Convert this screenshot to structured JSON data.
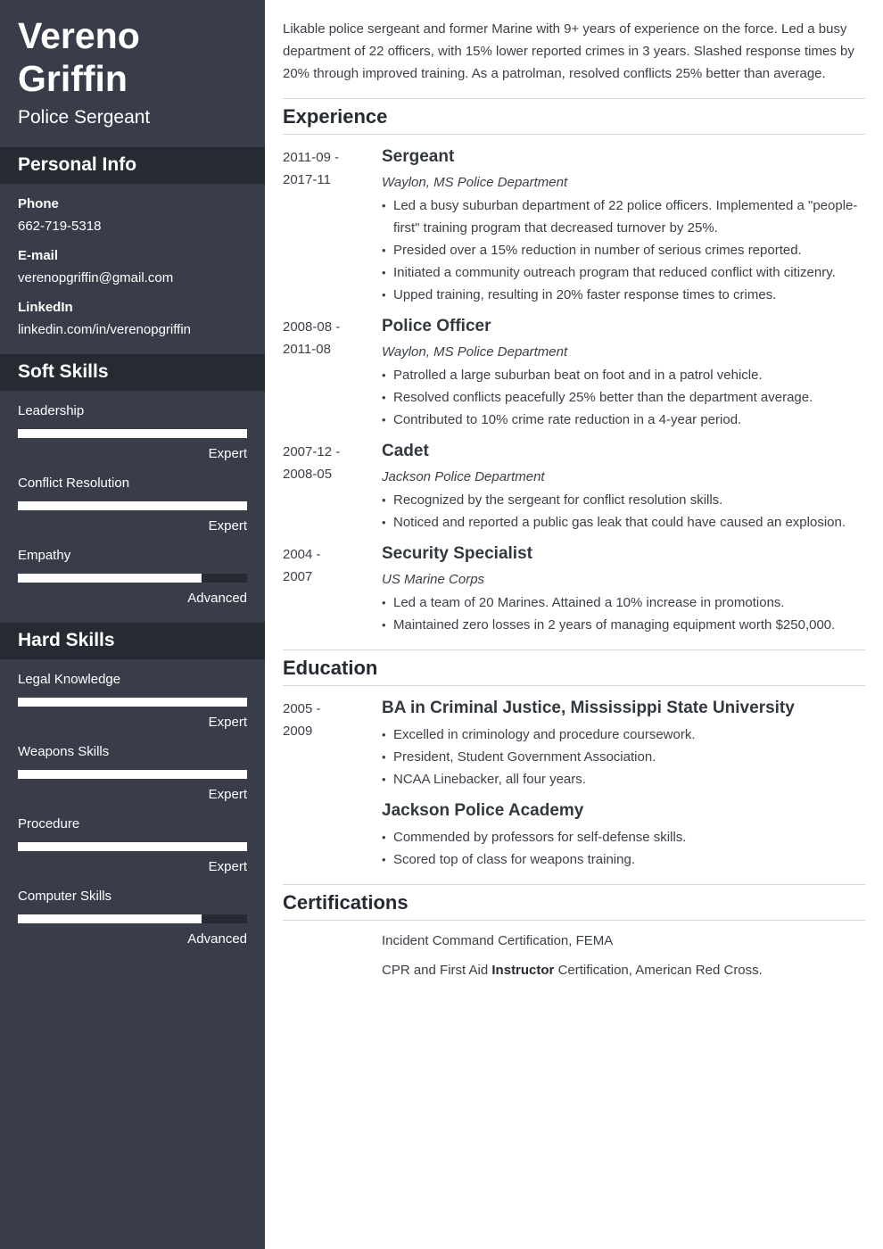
{
  "profile": {
    "first_name": "Vereno",
    "last_name": "Griffin",
    "title": "Police Sergeant"
  },
  "sidebar": {
    "personal_info": {
      "heading": "Personal Info",
      "items": [
        {
          "label": "Phone",
          "value": "662-719-5318"
        },
        {
          "label": "E-mail",
          "value": "verenopgriffin@gmail.com"
        },
        {
          "label": "LinkedIn",
          "value": "linkedin.com/in/verenopgriffin"
        }
      ]
    },
    "soft_skills": {
      "heading": "Soft Skills",
      "items": [
        {
          "name": "Leadership",
          "level": "Expert",
          "fraction": 1.0
        },
        {
          "name": "Conflict Resolution",
          "level": "Expert",
          "fraction": 1.0
        },
        {
          "name": "Empathy",
          "level": "Advanced",
          "fraction": 0.8
        }
      ]
    },
    "hard_skills": {
      "heading": "Hard Skills",
      "items": [
        {
          "name": "Legal Knowledge",
          "level": "Expert",
          "fraction": 1.0
        },
        {
          "name": "Weapons Skills",
          "level": "Expert",
          "fraction": 1.0
        },
        {
          "name": "Procedure",
          "level": "Expert",
          "fraction": 1.0
        },
        {
          "name": "Computer Skills",
          "level": "Advanced",
          "fraction": 0.8
        }
      ]
    }
  },
  "summary": "Likable police sergeant and former Marine with 9+ years of experience on the force. Led a busy department of 22 officers, with 15% lower reported crimes in 3 years. Slashed response times by 20% through improved training. As a patrolman, resolved conflicts 25% better than average.",
  "experience": {
    "heading": "Experience",
    "entries": [
      {
        "date_start": "2011-09 -",
        "date_end": "2017-11",
        "title": "Sergeant",
        "org": "Waylon, MS Police Department",
        "bullets": [
          "Led a busy suburban department of 22 police officers. Implemented a \"people-first\" training program that decreased turnover by 25%.",
          "Presided over a 15% reduction in number of serious crimes reported.",
          "Initiated a community outreach program that reduced conflict with citizenry.",
          "Upped training, resulting in 20% faster response times to crimes."
        ]
      },
      {
        "date_start": "2008-08 -",
        "date_end": "2011-08",
        "title": "Police Officer",
        "org": "Waylon, MS Police Department",
        "bullets": [
          "Patrolled a large suburban beat on foot and in a patrol vehicle.",
          "Resolved conflicts peacefully 25% better than the department average.",
          "Contributed to 10% crime rate reduction in a 4-year period."
        ]
      },
      {
        "date_start": "2007-12 -",
        "date_end": "2008-05",
        "title": "Cadet",
        "org": "Jackson Police Department",
        "bullets": [
          "Recognized by the sergeant for conflict resolution skills.",
          "Noticed and reported a public gas leak that could have caused an explosion."
        ]
      },
      {
        "date_start": "2004 -",
        "date_end": "2007",
        "title": "Security Specialist",
        "org": "US Marine Corps",
        "bullets": [
          "Led a team of 20 Marines. Attained a 10% increase in promotions.",
          "Maintained zero losses in 2 years of managing equipment worth $250,000."
        ]
      }
    ]
  },
  "education": {
    "heading": "Education",
    "entries": [
      {
        "date_start": "2005 -",
        "date_end": "2009",
        "title": "BA in Criminal Justice, Mississippi State University",
        "bullets": [
          "Excelled in criminology and procedure coursework.",
          "President, Student Government Association.",
          "NCAA Linebacker, all four years."
        ]
      },
      {
        "title": "Jackson Police Academy",
        "bullets": [
          "Commended by professors for self-defense skills.",
          "Scored top of class for weapons training."
        ]
      }
    ]
  },
  "certifications": {
    "heading": "Certifications",
    "items": [
      {
        "before": "Incident Command Certification, FEMA",
        "bold": "",
        "after": ""
      },
      {
        "before": "CPR and First Aid ",
        "bold": "Instructor",
        "after": " Certification, American Red Cross."
      }
    ]
  }
}
